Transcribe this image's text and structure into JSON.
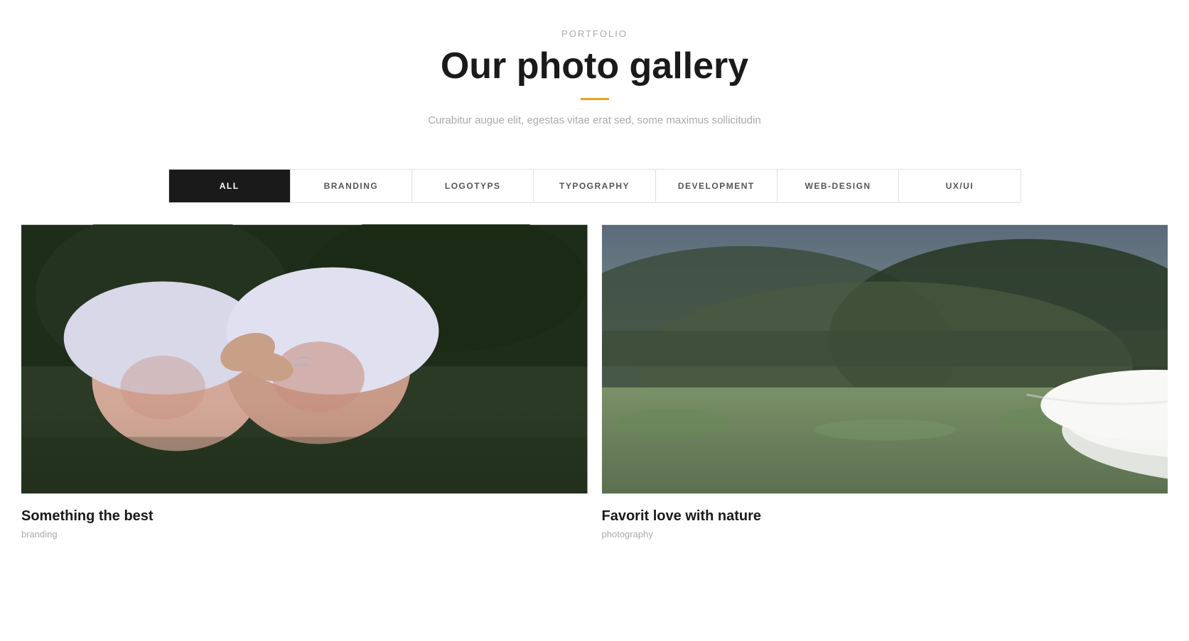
{
  "header": {
    "portfolio_label": "PORTFOLIO",
    "title": "Our photo gallery",
    "underline_color": "#e8a020",
    "description": "Curabitur augue elit, egestas vitae erat sed, some maximus sollicitudin"
  },
  "filters": {
    "tabs": [
      {
        "id": "all",
        "label": "ALL",
        "active": true
      },
      {
        "id": "branding",
        "label": "BRANDING",
        "active": false
      },
      {
        "id": "logotyps",
        "label": "LOGOTYPS",
        "active": false
      },
      {
        "id": "typography",
        "label": "TYPOGRAPHY",
        "active": false
      },
      {
        "id": "development",
        "label": "DEVELOPMENT",
        "active": false
      },
      {
        "id": "web-design",
        "label": "WEB-DESIGN",
        "active": false
      },
      {
        "id": "ux-ui",
        "label": "UX/UI",
        "active": false
      }
    ]
  },
  "gallery": {
    "items": [
      {
        "id": "item1",
        "title": "Something the best",
        "category": "branding",
        "image_type": "artistic-women"
      },
      {
        "id": "item2",
        "title": "Favorit love with nature",
        "category": "photography",
        "image_type": "nature-women"
      }
    ]
  }
}
